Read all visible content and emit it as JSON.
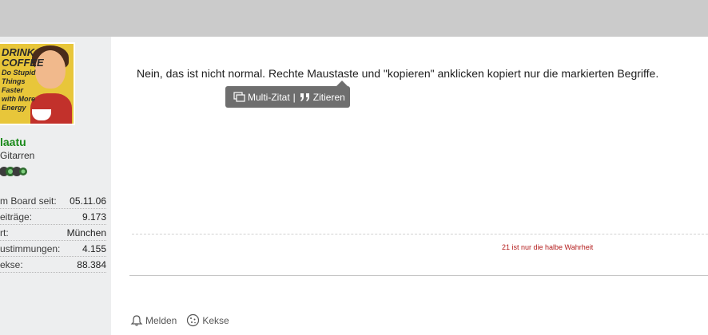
{
  "sidebar": {
    "avatar_text": [
      "DRINK",
      "COFFEE",
      "Do Stupid",
      "Things",
      "Faster",
      "with More",
      "Energy"
    ],
    "username": "laatu",
    "user_title": "Gitarren",
    "stats": [
      {
        "label": "m Board seit:",
        "value": "05.11.06"
      },
      {
        "label": "eiträge:",
        "value": "9.173"
      },
      {
        "label": "rt:",
        "value": "München"
      },
      {
        "label": "ustimmungen:",
        "value": "4.155"
      },
      {
        "label": "ekse:",
        "value": "88.384"
      }
    ]
  },
  "post": {
    "text": "Nein, das ist nicht normal. Rechte Maustaste und \"kopieren\" anklicken kopiert nur die markierten Begriffe."
  },
  "quote_popup": {
    "multi_quote": "Multi-Zitat",
    "separator": "|",
    "quote": "Zitieren"
  },
  "signature": "21 ist nur die halbe Wahrheit",
  "actions": {
    "report": "Melden",
    "cookies": "Kekse"
  },
  "colors": {
    "topbar": "#cbcbcb",
    "sidebar": "#edeeef",
    "username": "#1a8a1a",
    "signature": "#b31b1b",
    "popup": "#6e6e6e"
  }
}
